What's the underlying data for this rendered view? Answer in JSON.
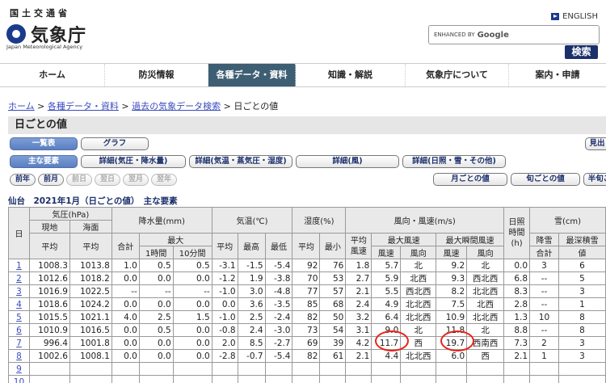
{
  "header": {
    "logo_small": "国土交通省",
    "logo": "気象庁",
    "logo_en": "Japan Meteorological Agency",
    "english": "ENGLISH",
    "search_placeholder": "ENHANCED BY",
    "search_google": "Google",
    "search_button": "検索"
  },
  "nav": [
    {
      "label": "ホーム"
    },
    {
      "label": "防災情報"
    },
    {
      "label": "各種データ・資料",
      "active": true
    },
    {
      "label": "知識・解説"
    },
    {
      "label": "気象庁について"
    },
    {
      "label": "案内・申請"
    }
  ],
  "breadcrumb": {
    "home": "ホーム",
    "data": "各種データ・資料",
    "search": "過去の気象データ検索",
    "current": "日ごとの値",
    "sep": " > "
  },
  "page_title": "日ごとの値",
  "view_buttons": {
    "table": "一覧表",
    "graph": "グラフ",
    "more": "見出"
  },
  "detail_buttons": {
    "main": "主な要素",
    "pressure": "詳細(気圧・降水量)",
    "temp": "詳細(気温・蒸気圧・湿度)",
    "wind": "詳細(風)",
    "sun": "詳細(日照・雪・その他)"
  },
  "period_buttons": {
    "prev_year": "前年",
    "prev_month": "前月",
    "prev_day": "前日",
    "next_day": "翌日",
    "next_month": "翌月",
    "next_year": "翌年",
    "monthly": "月ごとの値",
    "junly": "旬ごとの値",
    "half": "半旬ご"
  },
  "caption": "仙台　2021年1月（日ごとの値）　主な要素",
  "table": {
    "h_day": "日",
    "h_pressure": "気圧(hPa)",
    "h_local": "現地",
    "h_sea": "海面",
    "h_avg": "平均",
    "h_precip": "降水量(mm)",
    "h_total": "合計",
    "h_max": "最大",
    "h_1h": "1時間",
    "h_10m": "10分間",
    "h_temp": "気温(℃)",
    "h_high": "最高",
    "h_low": "最低",
    "h_hum": "湿度(%)",
    "h_min": "最小",
    "h_wind": "風向・風速(m/s)",
    "h_avg_speed": "平均風速",
    "h_max_wind": "最大風速",
    "h_gust": "最大瞬間風速",
    "h_speed": "風速",
    "h_dir": "風向",
    "h_sun": "日照時間(h)",
    "h_snow": "雪(cm)",
    "h_snowfall": "降雪",
    "h_snow_total": "合計",
    "h_snow_depth": "最深積雪",
    "h_value": "値",
    "rows": [
      [
        "1",
        "1008.3",
        "1013.8",
        "1.0",
        "0.5",
        "0.5",
        "-3.1",
        "-1.5",
        "-5.4",
        "92",
        "76",
        "1.8",
        "5.7",
        "北",
        "9.2",
        "北",
        "0.0",
        "3",
        "6"
      ],
      [
        "2",
        "1012.6",
        "1018.2",
        "0.0",
        "0.0",
        "0.0",
        "-1.2",
        "1.9",
        "-3.8",
        "70",
        "53",
        "2.7",
        "5.9",
        "北西",
        "9.3",
        "西北西",
        "6.8",
        "--",
        "5"
      ],
      [
        "3",
        "1016.9",
        "1022.5",
        "--",
        "--",
        "--",
        "-1.0",
        "3.0",
        "-4.8",
        "77",
        "57",
        "2.1",
        "5.5",
        "西北西",
        "8.2",
        "北北西",
        "8.3",
        "--",
        "3"
      ],
      [
        "4",
        "1018.6",
        "1024.2",
        "0.0",
        "0.0",
        "0.0",
        "0.0",
        "3.6",
        "-3.5",
        "85",
        "68",
        "2.4",
        "4.9",
        "北北西",
        "7.5",
        "北西",
        "2.8",
        "--",
        "1"
      ],
      [
        "5",
        "1015.5",
        "1021.1",
        "4.0",
        "2.5",
        "1.5",
        "-1.0",
        "2.5",
        "-2.4",
        "82",
        "50",
        "3.2",
        "6.4",
        "北北西",
        "10.9",
        "北北西",
        "1.3",
        "10",
        "8"
      ],
      [
        "6",
        "1010.9",
        "1016.5",
        "0.0",
        "0.5",
        "0.0",
        "-0.8",
        "2.4",
        "-3.0",
        "73",
        "54",
        "3.1",
        "9.0",
        "北",
        "11.8",
        "北",
        "8.8",
        "--",
        "8"
      ],
      [
        "7",
        "996.4",
        "1001.8",
        "0.0",
        "0.0",
        "0.0",
        "2.0",
        "8.5",
        "-2.7",
        "69",
        "39",
        "4.2",
        "11.7",
        "西",
        "19.7",
        "西南西",
        "7.3",
        "2",
        "3"
      ],
      [
        "8",
        "1002.6",
        "1008.1",
        "0.0",
        "0.0",
        "0.0",
        "-2.8",
        "-0.7",
        "-5.4",
        "82",
        "61",
        "2.1",
        "4.4",
        "北北西",
        "6.0",
        "西",
        "2.1",
        "1",
        "3"
      ],
      [
        "9",
        "",
        "",
        "",
        "",
        "",
        "",
        "",
        "",
        "",
        "",
        "",
        "",
        "",
        "",
        "",
        "",
        "",
        ""
      ],
      [
        "10",
        "",
        "",
        "",
        "",
        "",
        "",
        "",
        "",
        "",
        "",
        "",
        "",
        "",
        "",
        "",
        "",
        "",
        ""
      ]
    ]
  }
}
